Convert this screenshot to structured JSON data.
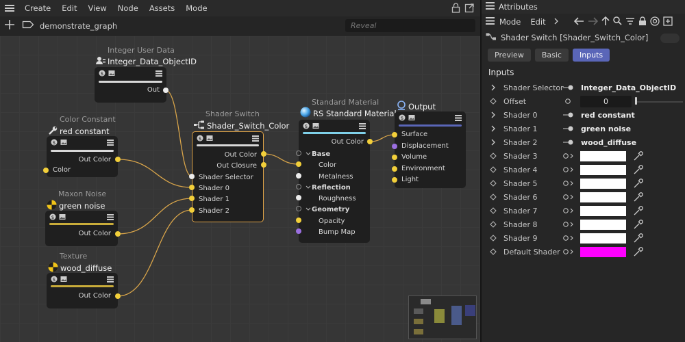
{
  "node_editor": {
    "menu": [
      "Create",
      "Edit",
      "View",
      "Node",
      "Assets",
      "Mode"
    ],
    "graph_name": "demonstrate_graph",
    "search_placeholder": "Reveal"
  },
  "nodes": {
    "integer": {
      "title": "Integer User Data",
      "name": "Integer_Data_ObjectID",
      "out": "Out"
    },
    "color_const": {
      "title": "Color Constant",
      "name": "red constant",
      "out": "Out Color",
      "in": "Color"
    },
    "noise": {
      "title": "Maxon Noise",
      "name": "green noise",
      "out": "Out Color"
    },
    "texture": {
      "title": "Texture",
      "name": "wood_diffuse",
      "out": "Out Color"
    },
    "switch": {
      "title": "Shader Switch",
      "name": "Shader_Switch_Color",
      "out1": "Out Color",
      "out2": "Out Closure",
      "inputs": [
        "Shader Selector",
        "Shader 0",
        "Shader 1",
        "Shader 2"
      ]
    },
    "material": {
      "title": "Standard Material",
      "name": "RS Standard Material",
      "out": "Out Color",
      "groups": [
        "Base",
        "Reflection",
        "Geometry"
      ],
      "ports": [
        "Color",
        "Metalness",
        "Roughness",
        "Opacity",
        "Bump Map"
      ]
    },
    "output": {
      "name": "Output",
      "ports": [
        "Surface",
        "Displacement",
        "Volume",
        "Environment",
        "Light"
      ]
    }
  },
  "attributes": {
    "panel_title": "Attributes",
    "menu": [
      "Mode",
      "Edit"
    ],
    "object": "Shader Switch [Shader_Switch_Color]",
    "tabs": [
      "Preview",
      "Basic",
      "Inputs"
    ],
    "active_tab": "Inputs",
    "section": "Inputs",
    "rows": {
      "shader_selector": {
        "label": "Shader Selector",
        "value": "Integer_Data_ObjectID"
      },
      "offset": {
        "label": "Offset",
        "value": "0"
      },
      "shader0": {
        "label": "Shader 0",
        "value": "red constant"
      },
      "shader1": {
        "label": "Shader 1",
        "value": "green noise"
      },
      "shader2": {
        "label": "Shader 2",
        "value": "wood_diffuse"
      },
      "shader3": {
        "label": "Shader 3"
      },
      "shader4": {
        "label": "Shader 4"
      },
      "shader5": {
        "label": "Shader 5"
      },
      "shader6": {
        "label": "Shader 6"
      },
      "shader7": {
        "label": "Shader 7"
      },
      "shader8": {
        "label": "Shader 8"
      },
      "shader9": {
        "label": "Shader 9"
      },
      "default_shader": {
        "label": "Default Shader",
        "color": "#ff00ff"
      }
    }
  },
  "colors": {
    "accent": "#5a66b8",
    "selection": "#e0a448",
    "wire": "#d9a54a",
    "port_yellow": "#f2cf3a",
    "port_purple": "#9b6fe0"
  }
}
